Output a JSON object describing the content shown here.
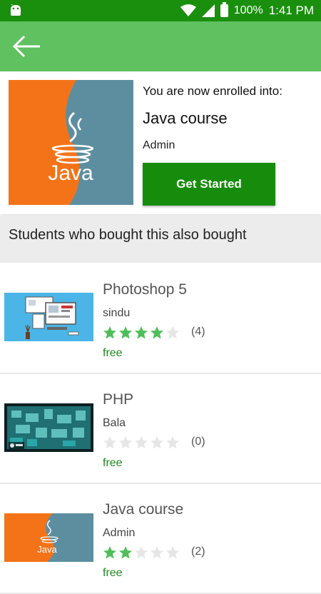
{
  "status_bar": {
    "battery_percent": "100%",
    "time": "1:41 PM",
    "icons": [
      "android-icon",
      "wifi-icon",
      "signal-icon",
      "battery-icon"
    ]
  },
  "toolbar": {
    "back_icon": "arrow-left-icon"
  },
  "enrolled": {
    "heading": "You are now enrolled into:",
    "course_title": "Java course",
    "author": "Admin",
    "button_label": "Get Started",
    "thumbnail_text": "Java"
  },
  "section": {
    "title": "Students who bought this also bought"
  },
  "courses": [
    {
      "title": "Photoshop 5",
      "author": "sindu",
      "rating": 4,
      "count": "(4)",
      "price": "free"
    },
    {
      "title": "PHP",
      "author": "Bala",
      "rating": 0,
      "count": "(0)",
      "price": "free"
    },
    {
      "title": "Java course",
      "author": "Admin",
      "rating": 2,
      "count": "(2)",
      "price": "free",
      "thumbnail_text": "Java"
    }
  ],
  "colors": {
    "status_bar": "#1a8f0e",
    "toolbar": "#60c161",
    "button": "#178c0c",
    "star_filled": "#4fbe5a",
    "star_empty": "#e6e6e6",
    "price": "#1d8a1d"
  }
}
